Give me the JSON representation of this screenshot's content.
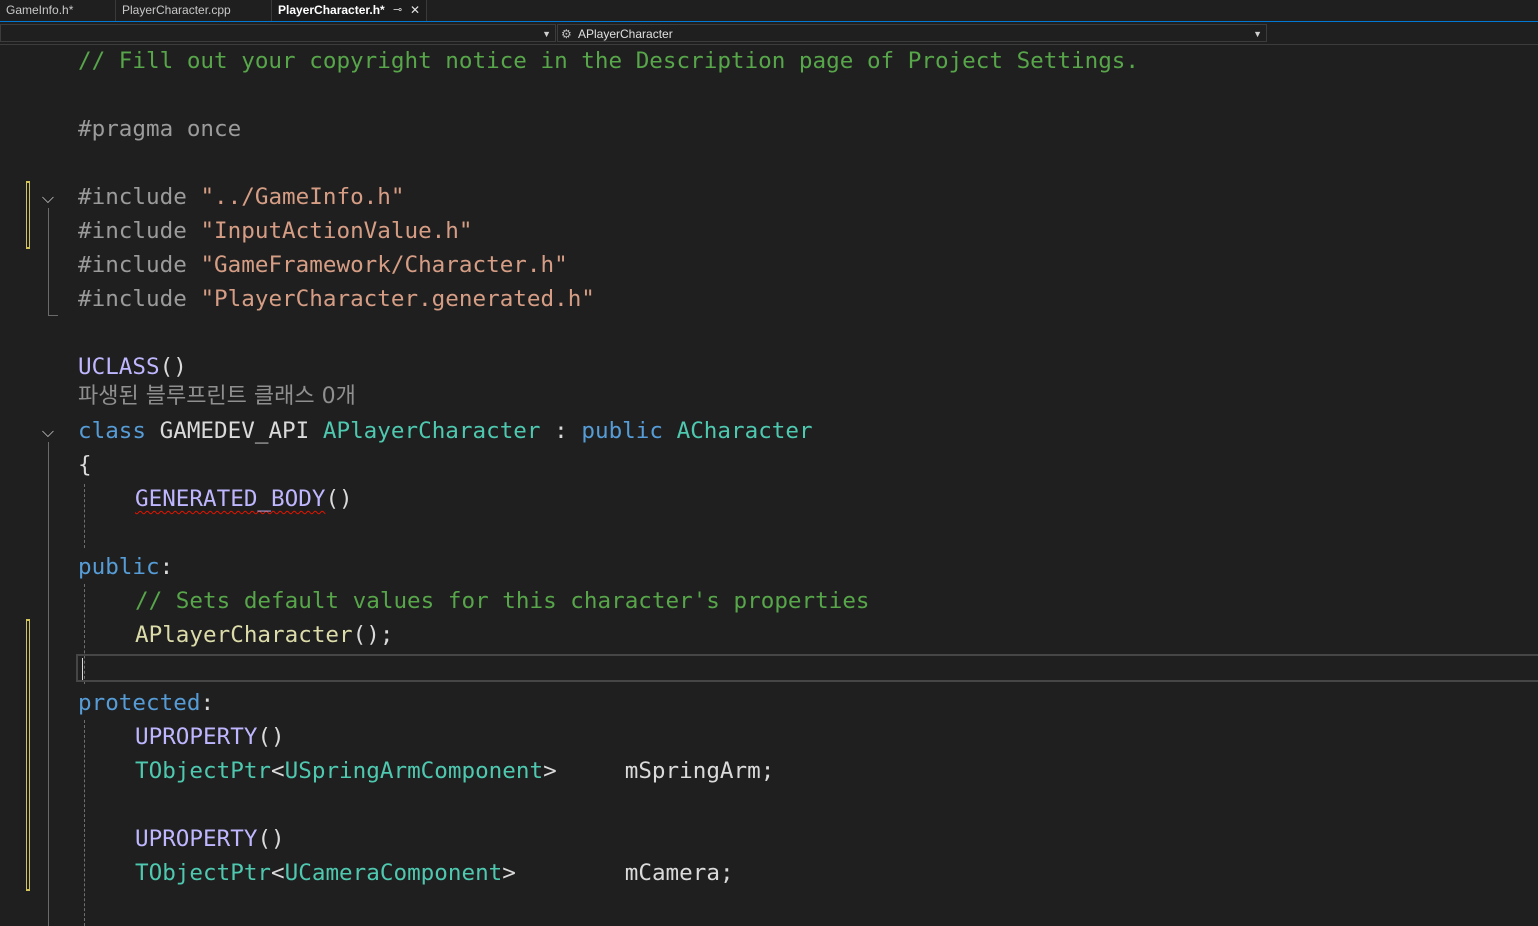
{
  "tabs": [
    {
      "label": "GameInfo.h*"
    },
    {
      "label": "PlayerCharacter.cpp"
    },
    {
      "label": "PlayerCharacter.h*",
      "active": true
    }
  ],
  "nav": {
    "right_label": "APlayerCharacter",
    "class_icon": "class-icon"
  },
  "code": {
    "l1": "// Fill out your copyright notice in the Description page of Project Settings.",
    "l3": "#pragma once",
    "inc_kw": "#include",
    "inc1": "\"../GameInfo.h\"",
    "inc2": "\"InputActionValue.h\"",
    "inc3": "\"GameFramework/Character.h\"",
    "inc4": "\"PlayerCharacter.generated.h\"",
    "uclass": "UCLASS",
    "parens": "()",
    "codelens": "파생된 블루프린트 클래스 0개",
    "class_kw": "class",
    "api": "GAMEDEV_API",
    "class_name": "APlayerCharacter",
    "colon": ":",
    "public_kw": "public",
    "base": "ACharacter",
    "brace": "{",
    "generated_body": "GENERATED_BODY",
    "public_label": "public",
    "label_colon": ":",
    "comment2": "// Sets default values for this character's properties",
    "ctor_name": "APlayerCharacter",
    "ctor_tail": "();",
    "protected_label": "protected",
    "uproperty": "UPROPERTY",
    "tobjectptr": "TObjectPtr",
    "lt": "<",
    "gt": ">",
    "springarm_type": "USpringArmComponent",
    "springarm_var": "mSpringArm",
    "camera_type": "UCameraComponent",
    "camera_var": "mCamera",
    "semi": ";"
  },
  "colors": {
    "background": "#1f1f1f",
    "comment": "#57a64a",
    "preprocessor": "#9b9b9b",
    "string": "#d69d85",
    "macro": "#beb7ff",
    "keyword": "#569cd6",
    "type": "#4ec9b0",
    "function": "#dcdcaa",
    "change_marker": "#cfc35a",
    "active_tab_accent": "#0078d4"
  }
}
